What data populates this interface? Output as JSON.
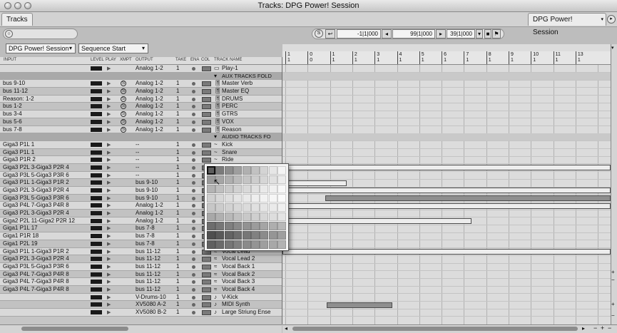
{
  "window": {
    "title": "Tracks: DPG Power! Session"
  },
  "tabs": {
    "left": "Tracks",
    "right": "DPG Power! Session"
  },
  "toolbar": {
    "search_icon": "search-icon",
    "session_popup": "DPG Power! Session",
    "sequence_popup": "Sequence Start",
    "counter_start": "-1|1|000",
    "counter_mid": "99|1|000",
    "counter_end": "39|1|000"
  },
  "columns": [
    "INPUT",
    "LEVEL",
    "PLAY",
    "XMPT",
    "OUTPUT",
    "TAKE",
    "ENA",
    "COL",
    "TRACK NAME"
  ],
  "tracks": [
    {
      "input": "",
      "output": "Analog 1-2",
      "take": "1",
      "name": "Play-1",
      "glyph": "▭",
      "kind": "audio",
      "xmpt": "",
      "folder": false
    },
    {
      "input": "",
      "output": "",
      "take": "",
      "name": "AUX TRACKS FOLD",
      "glyph": "▾",
      "kind": "folder",
      "xmpt": "",
      "folder": true
    },
    {
      "input": "bus 9-10",
      "output": "Analog 1-2",
      "take": "1",
      "name": "Master Verb",
      "glyph": "🎚",
      "kind": "aux",
      "xmpt": "S",
      "folder": false
    },
    {
      "input": "bus 11-12",
      "output": "Analog 1-2",
      "take": "1",
      "name": "Master EQ",
      "glyph": "🎚",
      "kind": "aux",
      "xmpt": "S",
      "folder": false
    },
    {
      "input": "Reason: 1-2",
      "output": "Analog 1-2",
      "take": "1",
      "name": "DRUMS",
      "glyph": "🎚",
      "kind": "aux",
      "xmpt": "S",
      "folder": false
    },
    {
      "input": "bus 1-2",
      "output": "Analog 1-2",
      "take": "1",
      "name": "PERC",
      "glyph": "🎚",
      "kind": "aux",
      "xmpt": "S",
      "folder": false
    },
    {
      "input": "bus 3-4",
      "output": "Analog 1-2",
      "take": "1",
      "name": "GTRS",
      "glyph": "🎚",
      "kind": "aux",
      "xmpt": "S",
      "folder": false
    },
    {
      "input": "bus 5-6",
      "output": "Analog 1-2",
      "take": "1",
      "name": "VOX",
      "glyph": "🎚",
      "kind": "aux",
      "xmpt": "S",
      "folder": false
    },
    {
      "input": "bus 7-8",
      "output": "Analog 1-2",
      "take": "1",
      "name": "Reason",
      "glyph": "🎚",
      "kind": "aux",
      "xmpt": "S",
      "folder": false
    },
    {
      "input": "",
      "output": "",
      "take": "",
      "name": "AUDIO TRACKS FO",
      "glyph": "▾",
      "kind": "folder",
      "xmpt": "",
      "folder": true
    },
    {
      "input": "Giga3 P1L 1",
      "output": "--",
      "take": "1",
      "name": "Kick",
      "glyph": "~",
      "kind": "audio",
      "xmpt": "",
      "folder": false
    },
    {
      "input": "Giga3 P1L 1",
      "output": "--",
      "take": "1",
      "name": "Snare",
      "glyph": "~",
      "kind": "audio",
      "xmpt": "",
      "folder": false
    },
    {
      "input": "Giga3 P1R 2",
      "output": "--",
      "take": "1",
      "name": "Ride",
      "glyph": "~",
      "kind": "audio",
      "xmpt": "",
      "folder": false
    },
    {
      "input": "Giga3 P2L 3-Giga3 P2R 4",
      "output": "--",
      "take": "1",
      "name": "",
      "glyph": "",
      "kind": "audio",
      "xmpt": "",
      "folder": false
    },
    {
      "input": "Giga3 P3L 5-Giga3 P3R 6",
      "output": "--",
      "take": "1",
      "name": "",
      "glyph": "",
      "kind": "audio",
      "xmpt": "",
      "folder": false
    },
    {
      "input": "Giga3 P1L 1-Giga3 P1R 2",
      "output": "bus 9-10",
      "take": "1",
      "name": "",
      "glyph": "",
      "kind": "audio",
      "xmpt": "",
      "folder": false
    },
    {
      "input": "Giga3 P2L 3-Giga3 P2R 4",
      "output": "bus 9-10",
      "take": "1",
      "name": "",
      "glyph": "",
      "kind": "audio",
      "xmpt": "",
      "folder": false
    },
    {
      "input": "Giga3 P3L 5-Giga3 P3R 6",
      "output": "bus 9-10",
      "take": "1",
      "name": "",
      "glyph": "",
      "kind": "audio",
      "xmpt": "",
      "folder": false
    },
    {
      "input": "Giga3 P4L 7-Giga3 P4R 8",
      "output": "Analog 1-2",
      "take": "1",
      "name": "",
      "glyph": "",
      "kind": "audio",
      "xmpt": "",
      "folder": false
    },
    {
      "input": "Giga3 P2L 3-Giga3 P2R 4",
      "output": "Analog 1-2",
      "take": "1",
      "name": "",
      "glyph": "",
      "kind": "audio",
      "xmpt": "",
      "folder": false
    },
    {
      "input": "Giga2 P2L 11-Giga2 P2R 12",
      "output": "Analog 1-2",
      "take": "1",
      "name": "",
      "glyph": "",
      "kind": "audio",
      "xmpt": "",
      "folder": false
    },
    {
      "input": "Giga1 P1L 17",
      "output": "bus 7-8",
      "take": "1",
      "name": "",
      "glyph": "",
      "kind": "audio",
      "xmpt": "",
      "folder": false
    },
    {
      "input": "Giga1 P1R 18",
      "output": "bus 7-8",
      "take": "1",
      "name": "",
      "glyph": "",
      "kind": "audio",
      "xmpt": "",
      "folder": false
    },
    {
      "input": "Giga1 P2L 19",
      "output": "bus 7-8",
      "take": "1",
      "name": "",
      "glyph": "",
      "kind": "audio",
      "xmpt": "",
      "folder": false
    },
    {
      "input": "Giga3 P1L 1-Giga3 P1R 2",
      "output": "bus 11-12",
      "take": "1",
      "name": "Vocal Lead",
      "glyph": "≈",
      "kind": "audio",
      "xmpt": "",
      "folder": false
    },
    {
      "input": "Giga3 P2L 3-Giga3 P2R 4",
      "output": "bus 11-12",
      "take": "1",
      "name": "Vocal Lead 2",
      "glyph": "≈",
      "kind": "audio",
      "xmpt": "",
      "folder": false
    },
    {
      "input": "Giga3 P3L 5-Giga3 P3R 6",
      "output": "bus 11-12",
      "take": "1",
      "name": "Vocal Back 1",
      "glyph": "≈",
      "kind": "audio",
      "xmpt": "",
      "folder": false
    },
    {
      "input": "Giga3 P4L 7-Giga3 P4R 8",
      "output": "bus 11-12",
      "take": "1",
      "name": "Vocal Back 2",
      "glyph": "≈",
      "kind": "audio",
      "xmpt": "",
      "folder": false
    },
    {
      "input": "Giga3 P4L 7-Giga3 P4R 8",
      "output": "bus 11-12",
      "take": "1",
      "name": "Vocal Back 3",
      "glyph": "≈",
      "kind": "audio",
      "xmpt": "",
      "folder": false
    },
    {
      "input": "Giga3 P4L 7-Giga3 P4R 8",
      "output": "bus 11-12",
      "take": "1",
      "name": "Vocal Back 4",
      "glyph": "≈",
      "kind": "audio",
      "xmpt": "",
      "folder": false
    },
    {
      "input": "",
      "output": "V-Drums-10",
      "take": "1",
      "name": "V-Kick",
      "glyph": "♪",
      "kind": "midi",
      "xmpt": "",
      "folder": false
    },
    {
      "input": "",
      "output": "XV5080 A-2",
      "take": "1",
      "name": "MIDI Synth",
      "glyph": "♪",
      "kind": "midi",
      "xmpt": "",
      "folder": false
    },
    {
      "input": "",
      "output": "XV5080 B-2",
      "take": "1",
      "name": "Large Striung Ense",
      "glyph": "♪",
      "kind": "midi",
      "xmpt": "",
      "folder": false
    }
  ],
  "ruler": {
    "measures": [
      "1",
      "0",
      "1",
      "1",
      "1",
      "1",
      "1",
      "1",
      "1",
      "1",
      "1",
      "1",
      "1",
      "1"
    ],
    "top": [
      "1",
      "0",
      "1",
      "2",
      "3",
      "4",
      "5",
      "6",
      "7",
      "8",
      "9",
      "10",
      "11",
      "13"
    ]
  },
  "palette": {
    "icon": "color-palette-popup",
    "colors": [
      [
        "#5c5c5c",
        "#7a7a7a",
        "#8c8c8c",
        "#9e9e9e",
        "#b0b0b0",
        "#c2c2c2",
        "#d4d4d4",
        "#e6e6e6",
        "#f4f4f4"
      ],
      [
        "#9a9a9a",
        "#a5a5a5",
        "#afafaf",
        "#bababa",
        "#c4c4c4",
        "#cdcdcd",
        "#d6d6d6",
        "#e0e0e0",
        "#ebebeb"
      ],
      [
        "#b4b4b4",
        "#bfbfbf",
        "#c9c9c9",
        "#d1d1d1",
        "#d9d9d9",
        "#e1e1e1",
        "#e9e9e9",
        "#f0f0f0",
        "#f7f7f7"
      ],
      [
        "#cfcfcf",
        "#d7d7d7",
        "#dedede",
        "#e4e4e4",
        "#e9e9e9",
        "#eeeeee",
        "#f2f2f2",
        "#f6f6f6",
        "#fafafa"
      ],
      [
        "#c7c7c7",
        "#cccccc",
        "#d2d2d2",
        "#d7d7d7",
        "#dbdbdb",
        "#e0e0e0",
        "#e5e5e5",
        "#eaeaea",
        "#f0f0f0"
      ],
      [
        "#a8a8a8",
        "#b0b0b0",
        "#b8b8b8",
        "#c0c0c0",
        "#c8c8c8",
        "#cfcfcf",
        "#d6d6d6",
        "#dddddd",
        "#e4e4e4"
      ],
      [
        "#6d6d6d",
        "#767676",
        "#7f7f7f",
        "#898989",
        "#929292",
        "#9c9c9c",
        "#a5a5a5",
        "#aeaeae",
        "#b8b8b8"
      ],
      [
        "#4f4f4f",
        "#595959",
        "#636363",
        "#6d6d6d",
        "#777777",
        "#818181",
        "#8b8b8b",
        "#959595",
        "#9f9f9f"
      ],
      [
        "#606060",
        "#6b6b6b",
        "#767676",
        "#808080",
        "#8a8a8a",
        "#949494",
        "#9e9e9e",
        "#a8a8a8",
        "#b2b2b2"
      ]
    ]
  }
}
